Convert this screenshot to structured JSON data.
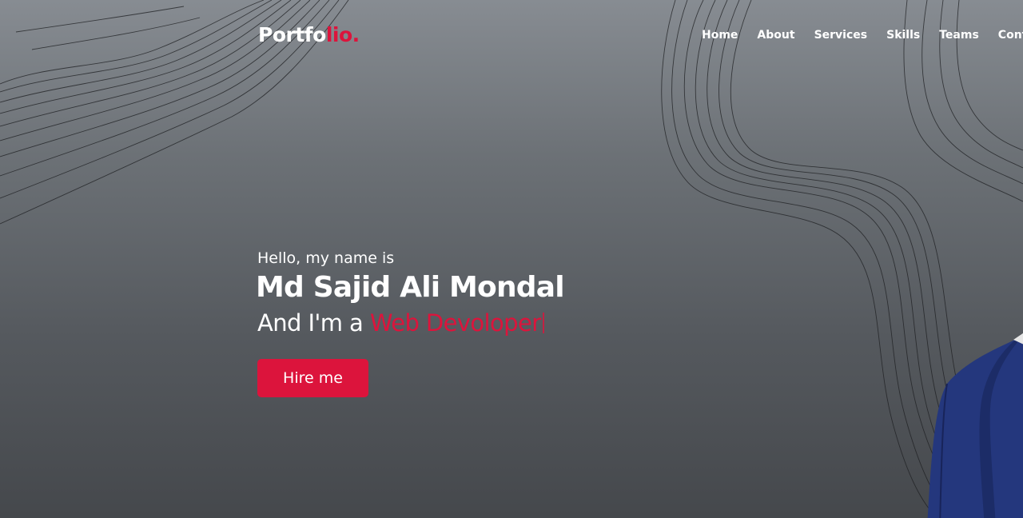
{
  "navbar": {
    "logo": {
      "main": "Portfo",
      "accent": "lio."
    },
    "menu": [
      "Home",
      "About",
      "Services",
      "Skills",
      "Teams",
      "Contact"
    ]
  },
  "hero": {
    "greeting": "Hello, my name is",
    "name": "Md Sajid Ali Mondal",
    "role_prefix": "And I'm a ",
    "role": "Web Devoloper",
    "cta_label": "Hire me"
  },
  "colors": {
    "accent": "#dc143c",
    "text": "#ffffff",
    "background": "#5a5e63",
    "suit": "#24377d"
  }
}
